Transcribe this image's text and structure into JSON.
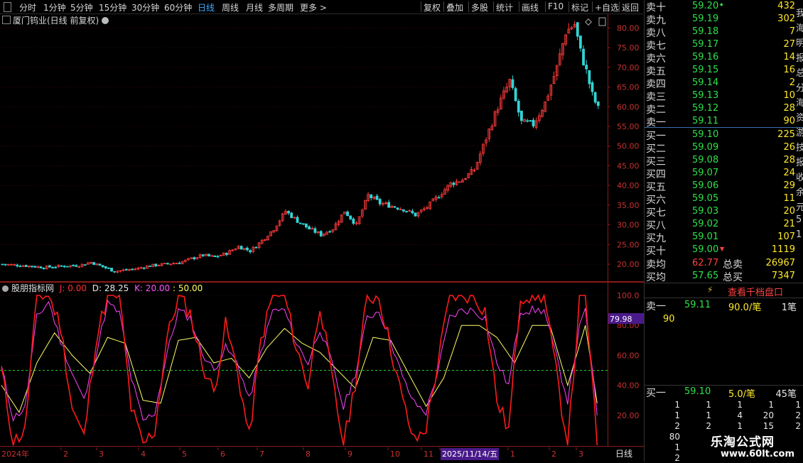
{
  "toolbar": {
    "periods": [
      "分时",
      "1分钟",
      "5分钟",
      "15分钟",
      "30分钟",
      "60分钟",
      "日线",
      "周线",
      "月线",
      "多周期",
      "更多 >"
    ],
    "active_period": "日线",
    "tools": [
      "复权",
      "叠加",
      "多股",
      "统计",
      "画线",
      "F10",
      "标记",
      "+自选",
      "返回"
    ]
  },
  "header": {
    "title": "厦门钨业(日线 前复权)"
  },
  "indicator": {
    "name": "股朋指标网",
    "j_label": "J: 0.00",
    "d_label": "D: 28.25",
    "k_label": "K: 20.00",
    "l_label": ": 50.00",
    "current_value": "79.98"
  },
  "date_axis": {
    "labels": [
      "2024年",
      "2",
      "3",
      "4",
      "5",
      "6",
      "7",
      "8",
      "9",
      "10",
      "11",
      "2025/11/14/五",
      "1",
      "2",
      "3"
    ],
    "period_label": "日线"
  },
  "colors": {
    "up": "#ff3b3b",
    "down": "#33d4d4",
    "k": "#ff44ff",
    "d": "#ffff66",
    "j": "#ff1a1a",
    "level": "#22cc22",
    "accent": "#3fa9ff"
  },
  "orderbook": {
    "sells": [
      {
        "label": "卖十",
        "price": "59.20",
        "vol": "432"
      },
      {
        "label": "卖九",
        "price": "59.19",
        "vol": "302"
      },
      {
        "label": "卖八",
        "price": "59.18",
        "vol": "7"
      },
      {
        "label": "卖七",
        "price": "59.17",
        "vol": "27"
      },
      {
        "label": "卖六",
        "price": "59.16",
        "vol": "14"
      },
      {
        "label": "卖五",
        "price": "59.15",
        "vol": "16"
      },
      {
        "label": "卖四",
        "price": "59.14",
        "vol": "2"
      },
      {
        "label": "卖三",
        "price": "59.13",
        "vol": "10"
      },
      {
        "label": "卖二",
        "price": "59.12",
        "vol": "28"
      },
      {
        "label": "卖一",
        "price": "59.11",
        "vol": "90"
      }
    ],
    "buys": [
      {
        "label": "买一",
        "price": "59.10",
        "vol": "225"
      },
      {
        "label": "买二",
        "price": "59.09",
        "vol": "26"
      },
      {
        "label": "买三",
        "price": "59.08",
        "vol": "28"
      },
      {
        "label": "买四",
        "price": "59.07",
        "vol": "24"
      },
      {
        "label": "买五",
        "price": "59.06",
        "vol": "29"
      },
      {
        "label": "买六",
        "price": "59.05",
        "vol": "11"
      },
      {
        "label": "买七",
        "price": "59.03",
        "vol": "20"
      },
      {
        "label": "买八",
        "price": "59.02",
        "vol": "21"
      },
      {
        "label": "买九",
        "price": "59.01",
        "vol": "107"
      },
      {
        "label": "买十",
        "price": "59.00",
        "vol": "1119"
      }
    ],
    "sell_avg_label": "卖均",
    "sell_avg": "62.77",
    "total_sell_label": "总卖",
    "total_sell": "26967",
    "buy_avg_label": "买均",
    "buy_avg": "57.65",
    "total_buy_label": "总买",
    "total_buy": "7347",
    "qiandang_label": "查看千档盘口",
    "sell1_label": "卖一",
    "sell1_price": "59.11",
    "sell1_detail": "90.0/笔",
    "sell1_count": "1笔",
    "sell1_queue": "90",
    "buy1_label": "买一",
    "buy1_price": "59.10",
    "buy1_detail": "5.0/笔",
    "buy1_count": "45笔",
    "buy1_queue": [
      [
        "1",
        "1",
        "1",
        "1",
        "1"
      ],
      [
        "1",
        "1",
        "4",
        "20",
        "2"
      ],
      [
        "2",
        "2",
        "1",
        "15",
        "2"
      ],
      [
        "80",
        "",
        "",
        "",
        ""
      ],
      [
        "1",
        "",
        "",
        "",
        ""
      ],
      [
        "2",
        "",
        "",
        "",
        ""
      ]
    ]
  },
  "edge_text": [
    "我",
    "海",
    "明",
    "报",
    "总",
    "分",
    "海",
    "资",
    "游",
    "技",
    "报",
    "收",
    "余",
    "元",
    "5",
    "1"
  ],
  "logo": {
    "main": "乐淘公式网",
    "sub": "www.60lt.com"
  },
  "chart_data": {
    "type": "candlestick",
    "price_axis": {
      "ticks": [
        "80.00",
        "75.00",
        "70.00",
        "65.00",
        "60.00",
        "55.00",
        "50.00",
        "45.00",
        "40.00",
        "35.00",
        "30.00",
        "25.00",
        "20.00"
      ],
      "ylim": [
        15.5,
        83.5
      ]
    },
    "indicator_axis": {
      "ticks": [
        "100.0",
        "80.00",
        "60.00",
        "40.00",
        "20.00"
      ],
      "ylim": [
        0,
        100
      ],
      "level": 50
    },
    "close_trend": [
      [
        0,
        20
      ],
      [
        8,
        19.6
      ],
      [
        14,
        19.2
      ],
      [
        20,
        19.5
      ],
      [
        26,
        19.7
      ],
      [
        30,
        20.5
      ],
      [
        38,
        18.2
      ],
      [
        45,
        18.8
      ],
      [
        50,
        19.6
      ],
      [
        56,
        20.1
      ],
      [
        60,
        20.4
      ],
      [
        64,
        21.4
      ],
      [
        68,
        22.3
      ],
      [
        72,
        21.8
      ],
      [
        76,
        22.8
      ],
      [
        80,
        24.5
      ],
      [
        84,
        23.4
      ],
      [
        88,
        26
      ],
      [
        92,
        29
      ],
      [
        96,
        33.5
      ],
      [
        100,
        31
      ],
      [
        104,
        29
      ],
      [
        108,
        27.5
      ],
      [
        112,
        29
      ],
      [
        116,
        33.5
      ],
      [
        120,
        30
      ],
      [
        124,
        37.5
      ],
      [
        128,
        35.5
      ],
      [
        132,
        34.8
      ],
      [
        136,
        34
      ],
      [
        140,
        32.5
      ],
      [
        144,
        34.5
      ],
      [
        148,
        37.5
      ],
      [
        152,
        40.5
      ],
      [
        156,
        41.5
      ],
      [
        160,
        44
      ],
      [
        164,
        52
      ],
      [
        168,
        60
      ],
      [
        172,
        66.5
      ],
      [
        176,
        56
      ],
      [
        180,
        55.5
      ],
      [
        184,
        61
      ],
      [
        188,
        70
      ],
      [
        191,
        79
      ],
      [
        194,
        81
      ],
      [
        196,
        74
      ],
      [
        198,
        69
      ],
      [
        200,
        63
      ],
      [
        202,
        59.5
      ]
    ],
    "k_series": [
      [
        0,
        52
      ],
      [
        4,
        18
      ],
      [
        8,
        25
      ],
      [
        12,
        85
      ],
      [
        16,
        96
      ],
      [
        20,
        70
      ],
      [
        24,
        48
      ],
      [
        28,
        30
      ],
      [
        32,
        60
      ],
      [
        36,
        95
      ],
      [
        40,
        88
      ],
      [
        44,
        45
      ],
      [
        48,
        16
      ],
      [
        52,
        22
      ],
      [
        56,
        60
      ],
      [
        60,
        90
      ],
      [
        64,
        85
      ],
      [
        68,
        62
      ],
      [
        72,
        50
      ],
      [
        76,
        65
      ],
      [
        80,
        55
      ],
      [
        84,
        30
      ],
      [
        88,
        62
      ],
      [
        92,
        90
      ],
      [
        96,
        90
      ],
      [
        100,
        68
      ],
      [
        104,
        55
      ],
      [
        108,
        78
      ],
      [
        112,
        55
      ],
      [
        116,
        25
      ],
      [
        120,
        48
      ],
      [
        124,
        85
      ],
      [
        128,
        90
      ],
      [
        132,
        70
      ],
      [
        136,
        45
      ],
      [
        140,
        28
      ],
      [
        144,
        22
      ],
      [
        148,
        50
      ],
      [
        152,
        85
      ],
      [
        156,
        90
      ],
      [
        160,
        90
      ],
      [
        164,
        85
      ],
      [
        168,
        55
      ],
      [
        172,
        40
      ],
      [
        176,
        90
      ],
      [
        180,
        90
      ],
      [
        184,
        90
      ],
      [
        188,
        60
      ],
      [
        192,
        30
      ],
      [
        196,
        78
      ],
      [
        198,
        90
      ],
      [
        202,
        20
      ]
    ],
    "d_series": [
      [
        0,
        40
      ],
      [
        6,
        22
      ],
      [
        12,
        55
      ],
      [
        18,
        75
      ],
      [
        24,
        60
      ],
      [
        30,
        48
      ],
      [
        36,
        72
      ],
      [
        42,
        68
      ],
      [
        48,
        30
      ],
      [
        54,
        28
      ],
      [
        60,
        70
      ],
      [
        66,
        72
      ],
      [
        72,
        55
      ],
      [
        78,
        58
      ],
      [
        84,
        45
      ],
      [
        90,
        65
      ],
      [
        96,
        78
      ],
      [
        102,
        68
      ],
      [
        108,
        62
      ],
      [
        114,
        50
      ],
      [
        120,
        38
      ],
      [
        126,
        72
      ],
      [
        132,
        70
      ],
      [
        138,
        48
      ],
      [
        144,
        26
      ],
      [
        150,
        45
      ],
      [
        156,
        80
      ],
      [
        162,
        80
      ],
      [
        168,
        72
      ],
      [
        174,
        55
      ],
      [
        180,
        80
      ],
      [
        186,
        80
      ],
      [
        192,
        40
      ],
      [
        198,
        80
      ],
      [
        202,
        28
      ]
    ],
    "j_series": [
      [
        0,
        50
      ],
      [
        4,
        2
      ],
      [
        8,
        10
      ],
      [
        12,
        100
      ],
      [
        16,
        100
      ],
      [
        20,
        80
      ],
      [
        24,
        25
      ],
      [
        28,
        5
      ],
      [
        32,
        70
      ],
      [
        36,
        100
      ],
      [
        40,
        100
      ],
      [
        44,
        25
      ],
      [
        48,
        0
      ],
      [
        52,
        10
      ],
      [
        56,
        70
      ],
      [
        60,
        100
      ],
      [
        64,
        88
      ],
      [
        68,
        55
      ],
      [
        72,
        35
      ],
      [
        76,
        80
      ],
      [
        80,
        50
      ],
      [
        84,
        5
      ],
      [
        88,
        70
      ],
      [
        92,
        100
      ],
      [
        96,
        100
      ],
      [
        100,
        65
      ],
      [
        104,
        40
      ],
      [
        108,
        95
      ],
      [
        112,
        45
      ],
      [
        116,
        0
      ],
      [
        120,
        42
      ],
      [
        124,
        98
      ],
      [
        128,
        100
      ],
      [
        132,
        65
      ],
      [
        136,
        30
      ],
      [
        140,
        2
      ],
      [
        144,
        12
      ],
      [
        148,
        55
      ],
      [
        152,
        100
      ],
      [
        156,
        100
      ],
      [
        160,
        100
      ],
      [
        164,
        90
      ],
      [
        168,
        30
      ],
      [
        172,
        10
      ],
      [
        176,
        100
      ],
      [
        180,
        100
      ],
      [
        184,
        100
      ],
      [
        188,
        50
      ],
      [
        192,
        0
      ],
      [
        196,
        95
      ],
      [
        198,
        100
      ],
      [
        202,
        0
      ]
    ]
  }
}
